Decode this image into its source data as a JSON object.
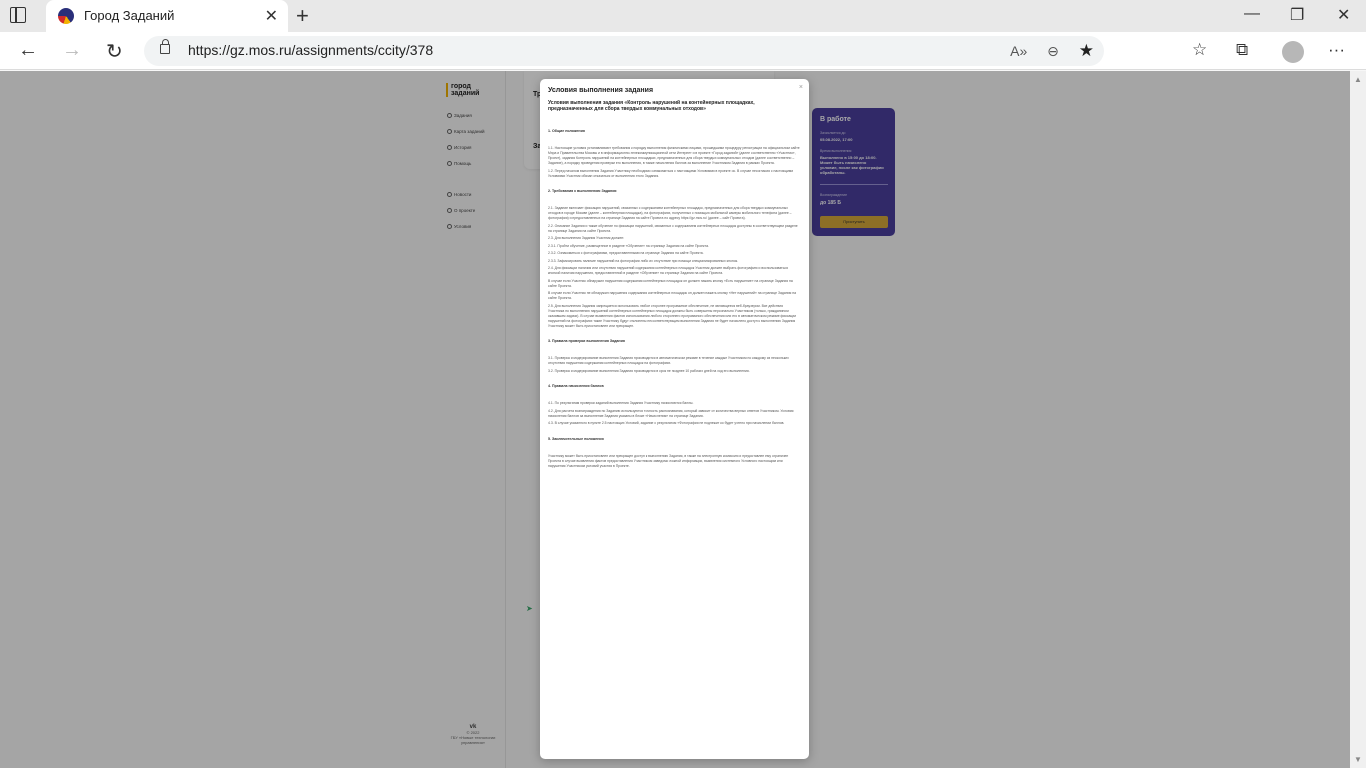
{
  "browser": {
    "tab_title": "Город Заданий",
    "url": "https://gz.mos.ru/assignments/ccity/378"
  },
  "sidebar": {
    "logo_line1": "город",
    "logo_line2": "заданий",
    "items": [
      "Задания",
      "Карта заданий",
      "История",
      "Помощь"
    ],
    "items2": [
      "Новости",
      "О проекте",
      "Условия"
    ],
    "footer_line1": "© 2022",
    "footer_line2": "ГБУ «Новые технологии",
    "footer_line3": "управления»"
  },
  "bg": {
    "card_title1": "Тр",
    "card_title2": "За"
  },
  "status_card": {
    "title": "В работе",
    "label1": "Зачисляется до",
    "value1": "05.08.2022, 17:00",
    "label2": "Время выполнения",
    "value2_l1": "Выполнено в 15:00 до 18:00.",
    "value2_l2": "Может быть начислено",
    "value2_l3": "условие, после как фотографии",
    "value2_l4": "обработаны.",
    "label3": "Вознаграждение",
    "price": "до 185 Б",
    "button": "Приступить"
  },
  "modal": {
    "title": "Условия выполнения задания",
    "subtitle": "Условия выполнения задания «Контроль нарушений на контейнерных площадках, предназначенных для сбора твердых коммунальных отходов»",
    "close": "×",
    "sections": [
      {
        "heading": "1. Общие положения",
        "paras": [
          "1.1. Настоящие условия устанавливают требования к порядку выполнения физическими лицами, прошедшими процедуру регистрации на официальном сайте Мэра и Правительства Москвы и в информационно-телекоммуникационной сети Интернет и в проекте «Город заданий» (далее соответственно «Участник», Проект), задания Контроль нарушений на контейнерных площадках, предназначенных для сбора твердых коммунальных отходов (далее соответственно – Задание), а порядку проведения проверки его выполнения, в также начисления баллов за выполнение Участником Задания в рамках Проекта.",
          "1.2. Перед началом выполнения Задания Участнику необходимо ознакомиться с настоящими Условиями в проекте ос. В случае несогласия с настоящими Условиями Участник обязан отказаться от выполнения этого Задания."
        ]
      },
      {
        "heading": "2. Требования к выполнению Задания",
        "paras": [
          "2.1. Задание включает фиксацию нарушений, связанных с содержанием контейнерных площадок, предназначенных для сбора твердых коммунальных отходов в городе Москве (далее – контейнерная площадка), на фотографиях, полученных с помощью мобильной камеры мобильного телефона (далее – фотография) и предоставленных на странице Задания на сайте Проекта по адресу https://gz.mos.ru/ (далее – сайт Проекта).",
          "2.2. Описание Задания и также обучение по фиксации нарушений, связанных с содержанием контейнерных площадок доступны в соответствующем разделе на странице Задания на сайте Проекта.",
          "2.3. Для выполнения Задания Участник должен:",
          "2.3.1. Пройти обучение, размещенное в разделе «Обучение» на странице Задания на сайте Проекта.",
          "2.3.2. Ознакомиться с фотографиями, предоставленными на странице Задания на сайте Проекта.",
          "2.3.3. Зафиксировать наличие нарушений на фотографии либо их отсутствие при помощи специализированных кнопок.",
          "2.4. Для фиксации наличия или отсутствия нарушений содержания контейнерных площадок Участник должен выбрать фотографию и воспользоваться кнопкой наличия нарушения, предоставленной в разделе «Обучение» на странице Задания на сайте Проекта.",
          "В случае если Участник обнаружил нарушения содержания контейнерных площадок он должен нажать кнопку «Есть нарушение» на странице Задания на сайте Проекта.",
          "В случае если Участник не обнаружил нарушения содержания контейнерных площадок он должен нажать кнопку «Нет нарушений» на странице Задания на сайте Проекта.",
          "2.5. Для выполнения Задания запрещается использовать любое сторонее программное обеспечение, не являющееся веб-браузером. Все действия Участника по выполнению нарушений контейнерных контейнерных площадок должны быть совершены персонально Участником (только, гражданином оказавшим задачи). В случае выявления фактов использования любого стороннего программного обеспечения или его в автоматическом режиме фиксации нарушений на фотографиях такие Участнику будут отклонены несоответствующим выполнении Задания не будет начислено доступ к выполнению Задания Участнику может быть приостановлен или прекращен."
        ]
      },
      {
        "heading": "3. Правила проверки выполнения Задания",
        "paras": [
          "3.1. Проверка и модерирование выполнения Задания производится в автоматическом режиме в течение каждые Участником по каждому из нескольких отсутствия нарушения содержания контейнерных площадок на фотографиях.",
          "3.2. Проверка и модерирование выполнения Задания производится в срок не позднее 10 рабочих дней на ход его выполнения."
        ]
      },
      {
        "heading": "4. Правила начисления баллов",
        "paras": [
          "4.1. По результатам проверки заданий выполнения Задания Участнику начисляются баллы.",
          "4.2. Для расчета вознаграждения по Заданию используются точность распознавания, который зависит от количества верных ответов Участником. Условия начисления баллов за выполнение Задания указаны в блоке «Начисления» на странице Задания.",
          "4.3. В случае указанного в пункте 2.5 настоящих Условий, задание с результатом «Фотография не подлежит ко будет учтено при начислении баллов."
        ]
      },
      {
        "heading": "5. Заключительные положения",
        "paras": [
          "Участнику может быть приостановлен или прекращен доступ к выполнению Задания, в также на электронную комиссию и предоставлен ему ограничен Проекта в случае выявления фактов предоставления Участником заведомо ложной информации, выявления системного Условного настоящим или нарушения Участником условий участия в Проекте."
        ]
      }
    ]
  }
}
